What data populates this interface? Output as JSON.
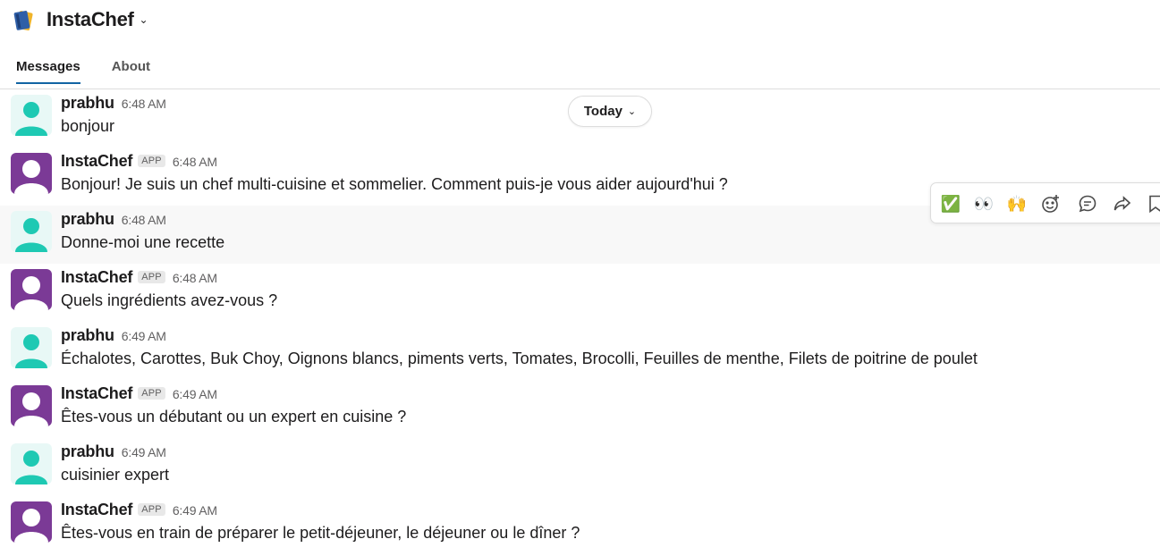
{
  "app": {
    "title": "InstaChef"
  },
  "tabs": [
    {
      "label": "Messages",
      "active": true
    },
    {
      "label": "About",
      "active": false
    }
  ],
  "date_divider": {
    "label": "Today"
  },
  "colors": {
    "user_avatar": "#1ec9b3",
    "bot_avatar": "#7b3a96",
    "accent": "#1264a3"
  },
  "messages": [
    {
      "author": "prabhu",
      "app": false,
      "time": "6:48 AM",
      "text": "bonjour"
    },
    {
      "author": "InstaChef",
      "app": true,
      "badge": "APP",
      "time": "6:48 AM",
      "text": "Bonjour! Je suis un chef multi-cuisine et sommelier. Comment puis-je vous aider aujourd'hui ?"
    },
    {
      "author": "prabhu",
      "app": false,
      "time": "6:48 AM",
      "text": "Donne-moi une recette"
    },
    {
      "author": "InstaChef",
      "app": true,
      "badge": "APP",
      "time": "6:48 AM",
      "text": "Quels ingrédients avez-vous ?"
    },
    {
      "author": "prabhu",
      "app": false,
      "time": "6:49 AM",
      "text": "Échalotes, Carottes, Buk Choy, Oignons blancs, piments verts, Tomates, Brocolli, Feuilles de menthe, Filets de poitrine de poulet"
    },
    {
      "author": "InstaChef",
      "app": true,
      "badge": "APP",
      "time": "6:49 AM",
      "text": "Êtes-vous un débutant ou un expert en cuisine ?"
    },
    {
      "author": "prabhu",
      "app": false,
      "time": "6:49 AM",
      "text": "cuisinier expert"
    },
    {
      "author": "InstaChef",
      "app": true,
      "badge": "APP",
      "time": "6:49 AM",
      "text": "Êtes-vous en train de préparer le petit-déjeuner, le déjeuner ou le dîner ?"
    }
  ],
  "message_actions": [
    {
      "icon": "white-check-mark-icon",
      "glyph": "✅"
    },
    {
      "icon": "eyes-icon",
      "glyph": "👀"
    },
    {
      "icon": "raised-hands-icon",
      "glyph": "🙌"
    },
    {
      "icon": "add-reaction-icon",
      "glyph": ""
    },
    {
      "icon": "reply-in-thread-icon",
      "glyph": ""
    },
    {
      "icon": "share-icon",
      "glyph": ""
    },
    {
      "icon": "bookmark-icon",
      "glyph": ""
    }
  ]
}
